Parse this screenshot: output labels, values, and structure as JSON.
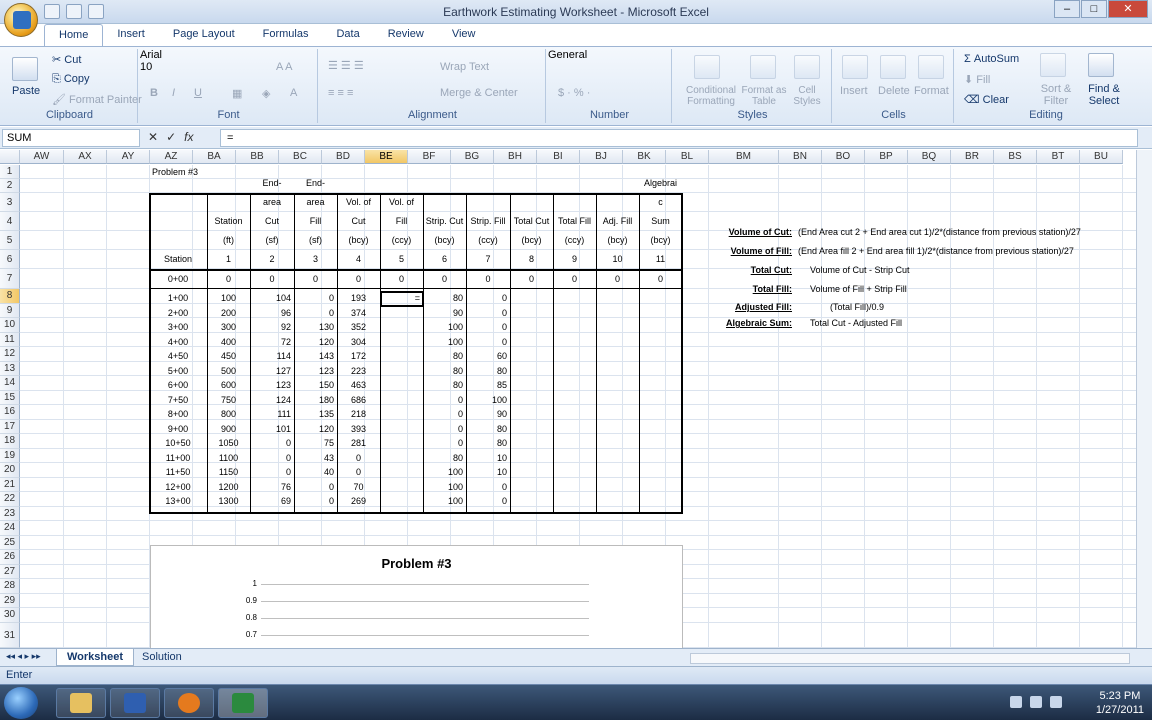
{
  "window": {
    "title": "Earthwork Estimating Worksheet - Microsoft Excel"
  },
  "tabs": [
    "Home",
    "Insert",
    "Page Layout",
    "Formulas",
    "Data",
    "Review",
    "View"
  ],
  "ribbon": {
    "clipboard": {
      "label": "Clipboard",
      "paste": "Paste",
      "cut": "Cut",
      "copy": "Copy",
      "format_painter": "Format Painter"
    },
    "font": {
      "label": "Font",
      "name": "Arial",
      "size": "10"
    },
    "alignment": {
      "label": "Alignment",
      "wrap": "Wrap Text",
      "merge": "Merge & Center"
    },
    "number": {
      "label": "Number",
      "format": "General"
    },
    "styles": {
      "label": "Styles",
      "cond": "Conditional Formatting",
      "table": "Format as Table",
      "cell": "Cell Styles"
    },
    "cells": {
      "label": "Cells",
      "insert": "Insert",
      "delete": "Delete",
      "format": "Format"
    },
    "editing": {
      "label": "Editing",
      "autosum": "AutoSum",
      "fill": "Fill",
      "clear": "Clear",
      "sort": "Sort & Filter",
      "find": "Find & Select"
    }
  },
  "formula_bar": {
    "name_box": "SUM",
    "formula": "="
  },
  "columns": [
    "AW",
    "AX",
    "AY",
    "AZ",
    "BA",
    "BB",
    "BC",
    "BD",
    "BE",
    "BF",
    "BG",
    "BH",
    "BI",
    "BJ",
    "BK",
    "BL",
    "BM",
    "BN",
    "BO",
    "BP",
    "BQ",
    "BR",
    "BS",
    "BT",
    "BU"
  ],
  "rows": [
    "1",
    "2",
    "3",
    "4",
    "5",
    "6",
    "7",
    "8",
    "9",
    "10",
    "11",
    "12",
    "13",
    "14",
    "15",
    "16",
    "17",
    "18",
    "19",
    "20",
    "21",
    "22",
    "23",
    "24",
    "25",
    "26",
    "27",
    "28",
    "29",
    "30",
    "31"
  ],
  "sheet": {
    "problem_label": "Problem #3",
    "headers": [
      [
        "Station"
      ],
      [
        "Station",
        "(ft)",
        "1"
      ],
      [
        "End-",
        "area",
        "Cut",
        "(sf)",
        "2"
      ],
      [
        "End-",
        "area",
        "Fill",
        "(sf)",
        "3"
      ],
      [
        "Vol. of",
        "Cut",
        "(bcy)",
        "4"
      ],
      [
        "Vol. of",
        "Fill",
        "(ccy)",
        "5"
      ],
      [
        "Strip. Cut",
        "(bcy)",
        "6"
      ],
      [
        "Strip. Fill",
        "(ccy)",
        "7"
      ],
      [
        "Total Cut",
        "(bcy)",
        "8"
      ],
      [
        "Total Fill",
        "(ccy)",
        "9"
      ],
      [
        "Adj. Fill",
        "(bcy)",
        "10"
      ],
      [
        "Algebrai",
        "c",
        "Sum",
        "(bcy)",
        "11"
      ]
    ],
    "data_rows": [
      [
        "0+00",
        "0",
        "0",
        "0",
        "0",
        "0",
        "0",
        "0",
        "0",
        "0",
        "0",
        "0"
      ],
      [
        "1+00",
        "100",
        "104",
        "0",
        "193",
        "=",
        "80",
        "0",
        "",
        "",
        "",
        ""
      ],
      [
        "2+00",
        "200",
        "96",
        "0",
        "374",
        "",
        "90",
        "0",
        "",
        "",
        "",
        ""
      ],
      [
        "3+00",
        "300",
        "92",
        "130",
        "352",
        "",
        "100",
        "0",
        "",
        "",
        "",
        ""
      ],
      [
        "4+00",
        "400",
        "72",
        "120",
        "304",
        "",
        "100",
        "0",
        "",
        "",
        "",
        ""
      ],
      [
        "4+50",
        "450",
        "114",
        "143",
        "172",
        "",
        "80",
        "60",
        "",
        "",
        "",
        ""
      ],
      [
        "5+00",
        "500",
        "127",
        "123",
        "223",
        "",
        "80",
        "80",
        "",
        "",
        "",
        ""
      ],
      [
        "6+00",
        "600",
        "123",
        "150",
        "463",
        "",
        "80",
        "85",
        "",
        "",
        "",
        ""
      ],
      [
        "7+50",
        "750",
        "124",
        "180",
        "686",
        "",
        "0",
        "100",
        "",
        "",
        "",
        ""
      ],
      [
        "8+00",
        "800",
        "111",
        "135",
        "218",
        "",
        "0",
        "90",
        "",
        "",
        "",
        ""
      ],
      [
        "9+00",
        "900",
        "101",
        "120",
        "393",
        "",
        "0",
        "80",
        "",
        "",
        "",
        ""
      ],
      [
        "10+50",
        "1050",
        "0",
        "75",
        "281",
        "",
        "0",
        "80",
        "",
        "",
        "",
        ""
      ],
      [
        "11+00",
        "1100",
        "0",
        "43",
        "0",
        "",
        "80",
        "10",
        "",
        "",
        "",
        ""
      ],
      [
        "11+50",
        "1150",
        "0",
        "40",
        "0",
        "",
        "100",
        "10",
        "",
        "",
        "",
        ""
      ],
      [
        "12+00",
        "1200",
        "76",
        "0",
        "70",
        "",
        "100",
        "0",
        "",
        "",
        "",
        ""
      ],
      [
        "13+00",
        "1300",
        "69",
        "0",
        "269",
        "",
        "100",
        "0",
        "",
        "",
        "",
        ""
      ]
    ],
    "notes": [
      {
        "label": "Volume of Cut:",
        "text": "(End Area cut 2 + End area cut 1)/2*(distance from previous station)/27"
      },
      {
        "label": "Volume of Fill:",
        "text": "(End Area fill 2 + End area fill 1)/2*(distance from previous station)/27"
      },
      {
        "label": "Total Cut:",
        "text": "Volume of Cut - Strip Cut"
      },
      {
        "label": "Total Fill:",
        "text": "Volume of Fill + Strip Fill"
      },
      {
        "label": "Adjusted Fill:",
        "text": "(Total Fill)/0.9"
      },
      {
        "label": "Algebraic Sum:",
        "text": "Total Cut - Adjusted Fill"
      }
    ]
  },
  "chart": {
    "title": "Problem #3",
    "yticks": [
      "1",
      "0.9",
      "0.8",
      "0.7"
    ]
  },
  "sheet_tabs": [
    "Worksheet",
    "Solution"
  ],
  "status": {
    "mode": "Enter"
  },
  "taskbar": {
    "time": "5:23 PM",
    "date": "1/27/2011"
  }
}
